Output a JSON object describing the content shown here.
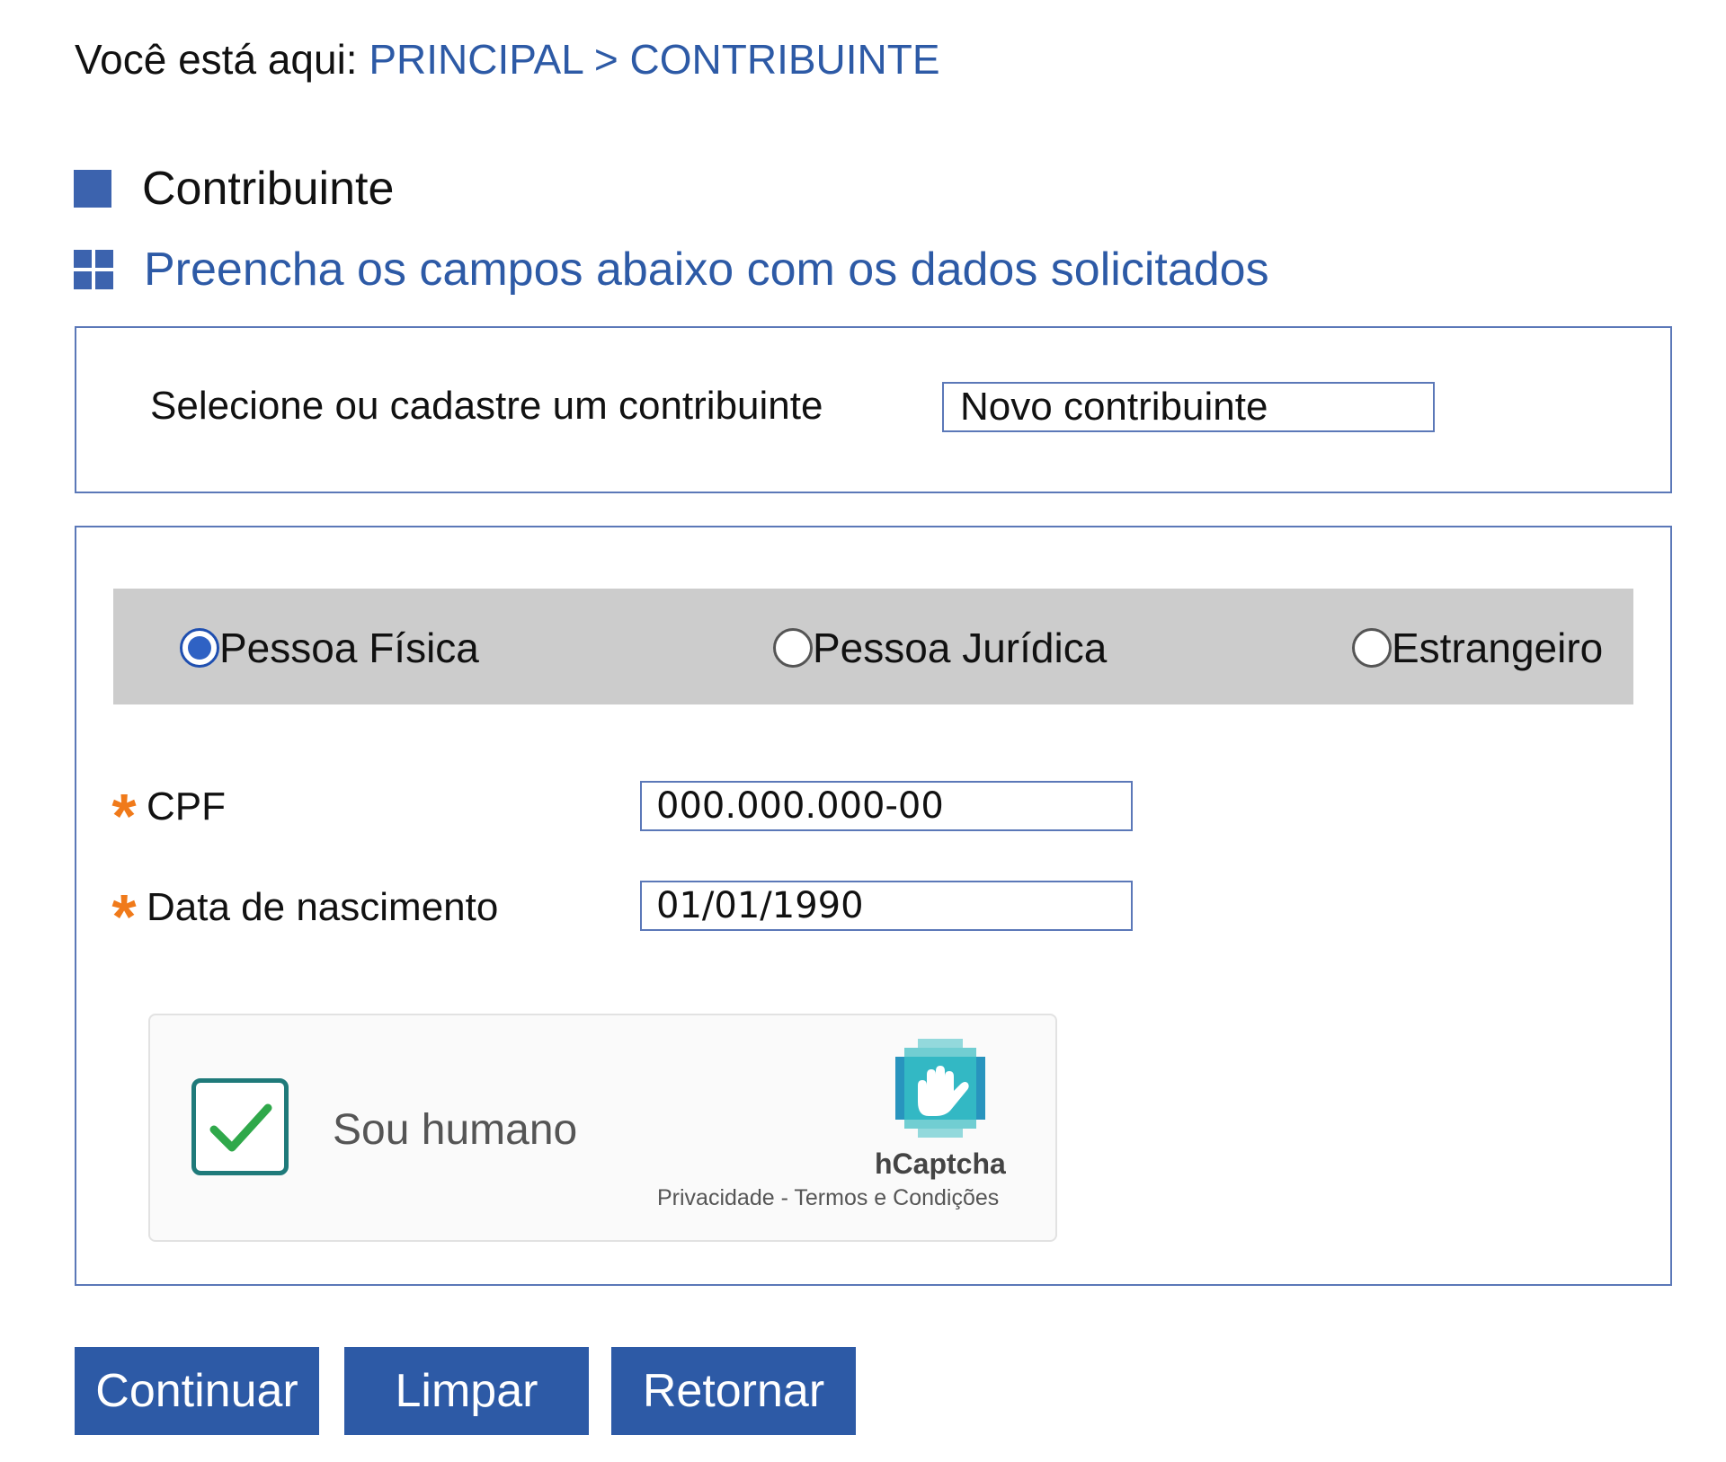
{
  "breadcrumb": {
    "prefix": "Você está aqui:",
    "home": "PRINCIPAL",
    "separator": ">",
    "current": "CONTRIBUINTE"
  },
  "page": {
    "title": "Contribuinte",
    "subtitle": "Preencha os campos abaixo com os dados solicitados"
  },
  "selector": {
    "label": "Selecione ou cadastre um contribuinte",
    "value": "Novo contribuinte"
  },
  "person_type": {
    "options": [
      {
        "label": "Pessoa Física",
        "checked": true
      },
      {
        "label": "Pessoa Jurídica",
        "checked": false
      },
      {
        "label": "Estrangeiro",
        "checked": false
      }
    ]
  },
  "form": {
    "required_mark": "*",
    "cpf_label": "CPF",
    "cpf_value": "000.000.000-00",
    "birth_label": "Data de nascimento",
    "birth_value": "01/01/1990"
  },
  "captcha": {
    "label": "Sou humano",
    "checked": true,
    "brand": "hCaptcha",
    "privacy": "Privacidade",
    "link_separator": " - ",
    "terms": "Termos e Condições"
  },
  "buttons": {
    "continue": "Continuar",
    "clear": "Limpar",
    "back": "Retornar"
  },
  "colors": {
    "accent_blue": "#2d5aa6",
    "required_orange": "#f07a1a",
    "radio_bar_gray": "#cccccc",
    "captcha_check_teal": "#1f7a7a"
  }
}
